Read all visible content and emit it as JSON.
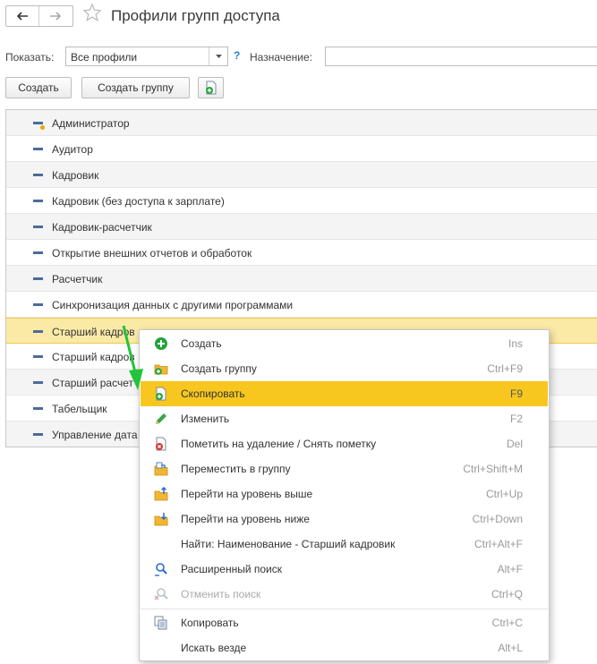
{
  "header": {
    "title": "Профили групп доступа"
  },
  "filter": {
    "show_label": "Показать:",
    "show_value": "Все профили",
    "help": "?",
    "purpose_label": "Назначение:",
    "purpose_value": ""
  },
  "toolbar": {
    "create_label": "Создать",
    "create_group_label": "Создать группу"
  },
  "list": {
    "rows": [
      "Администратор",
      "Аудитор",
      "Кадровик",
      "Кадровик (без доступа к зарплате)",
      "Кадровик-расчетчик",
      "Открытие внешних отчетов и обработок",
      "Расчетчик",
      "Синхронизация данных с другими программами",
      "Старший кадров",
      "Старший кадров",
      "Старший расчет",
      "Табельщик",
      "Управление дата"
    ]
  },
  "context_menu": {
    "items": [
      {
        "label": "Создать",
        "shortcut": "Ins",
        "icon": "plus-circle-icon"
      },
      {
        "label": "Создать группу",
        "shortcut": "Ctrl+F9",
        "icon": "folder-plus-icon"
      },
      {
        "label": "Скопировать",
        "shortcut": "F9",
        "icon": "copy-item-icon"
      },
      {
        "label": "Изменить",
        "shortcut": "F2",
        "icon": "pencil-icon"
      },
      {
        "label": "Пометить на удаление / Снять пометку",
        "shortcut": "Del",
        "icon": "mark-delete-icon"
      },
      {
        "label": "Переместить в группу",
        "shortcut": "Ctrl+Shift+M",
        "icon": "move-to-group-icon"
      },
      {
        "label": "Перейти на уровень выше",
        "shortcut": "Ctrl+Up",
        "icon": "level-up-icon"
      },
      {
        "label": "Перейти на уровень ниже",
        "shortcut": "Ctrl+Down",
        "icon": "level-down-icon"
      },
      {
        "label": "Найти: Наименование - Старший кадровик",
        "shortcut": "Ctrl+Alt+F",
        "icon": ""
      },
      {
        "label": "Расширенный поиск",
        "shortcut": "Alt+F",
        "icon": "advanced-search-icon"
      },
      {
        "label": "Отменить поиск",
        "shortcut": "Ctrl+Q",
        "icon": "cancel-search-icon"
      },
      {
        "label": "Копировать",
        "shortcut": "Ctrl+C",
        "icon": "copy-icon"
      },
      {
        "label": "Искать везде",
        "shortcut": "Alt+L",
        "icon": ""
      }
    ]
  },
  "colors": {
    "highlight": "#f7c71f",
    "selected_row": "#fbe9a6",
    "accent_green": "#21a33a"
  }
}
